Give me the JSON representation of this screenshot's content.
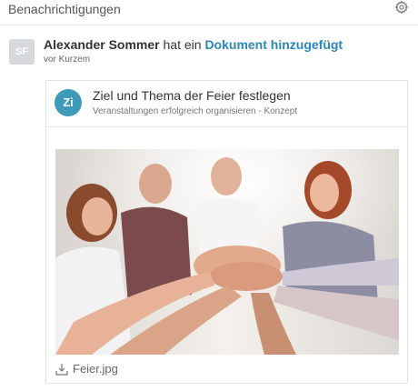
{
  "header": {
    "title": "Benachrichtigungen",
    "settings_icon": "gear-icon"
  },
  "notification": {
    "avatar_initials": "SF",
    "actor": "Alexander Sommer",
    "verb": "hat ein",
    "object": "Dokument hinzugefügt",
    "time": "vor Kurzem"
  },
  "document": {
    "initials": "Zi",
    "title": "Ziel und Thema der Feier festlegen",
    "subtitle": "Veranstaltungen erfolgreich organisieren - Konzept",
    "attachment": {
      "name": "Feier.jpg",
      "icon": "download-icon"
    }
  },
  "colors": {
    "link": "#2a87b7",
    "doc_avatar": "#3d9ab8",
    "avatar": "#d6d9dc"
  }
}
